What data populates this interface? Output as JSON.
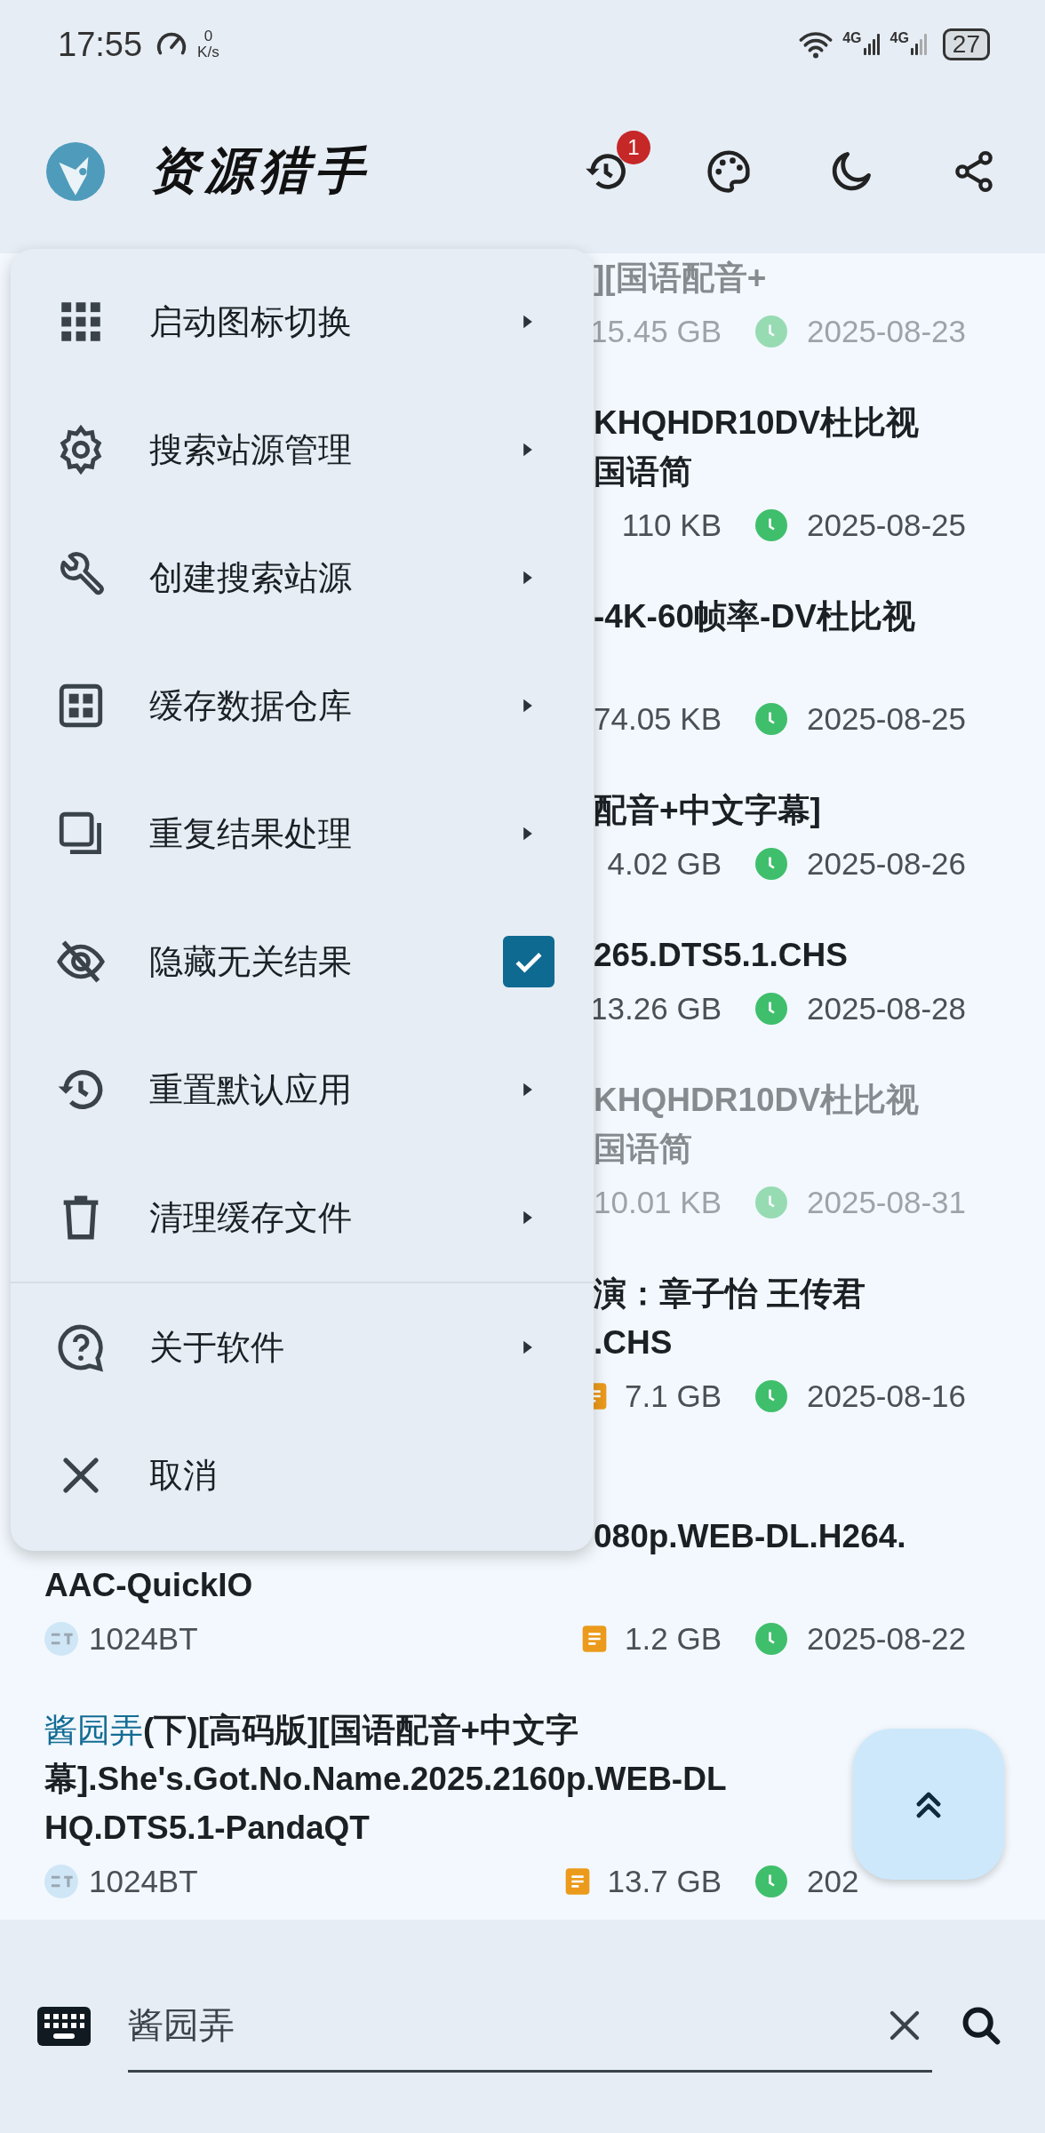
{
  "status_bar": {
    "time": "17:55",
    "speed_value": "0",
    "speed_unit": "K/s",
    "networks": [
      {
        "label": "4G"
      },
      {
        "label": "4G"
      }
    ],
    "battery": "27"
  },
  "app_bar": {
    "title": "资源猎手",
    "history_badge": "1"
  },
  "results": [
    {
      "lines": [
        {
          "text": "][国语配音+",
          "cut": true
        }
      ],
      "size": "15.45 GB",
      "date": "2025-08-23",
      "dimmed": true
    },
    {
      "lines": [
        {
          "text": "KHQHDR10DV杜比视",
          "cut": true
        },
        {
          "text": "国语简",
          "cut": true
        }
      ],
      "size": "110 KB",
      "date": "2025-08-25",
      "dimmed": false
    },
    {
      "lines": [
        {
          "text": "-4K-60帧率-DV杜比视",
          "cut": true
        }
      ],
      "size": "74.05 KB",
      "date": "2025-08-25",
      "dimmed": false
    },
    {
      "lines": [
        {
          "text": "配音+中文字幕]",
          "cut": true
        }
      ],
      "size": "4.02 GB",
      "date": "2025-08-26",
      "dimmed": false
    },
    {
      "lines": [
        {
          "text": "265.DTS5.1.CHS",
          "cut": true
        }
      ],
      "size": "13.26 GB",
      "date": "2025-08-28",
      "dimmed": false
    },
    {
      "lines": [
        {
          "text": "KHQHDR10DV杜比视",
          "cut": true
        },
        {
          "text": "国语简",
          "cut": true
        }
      ],
      "size": "10.01 KB",
      "date": "2025-08-31",
      "dimmed": true
    },
    {
      "lines": [
        {
          "text": "演：章子怡 王传君",
          "cut": true
        },
        {
          "text": ".CHS",
          "cut": true
        }
      ],
      "size_icon": true,
      "size": "7.1 GB",
      "date": "2025-08-16",
      "dimmed": false
    },
    {
      "lines": [
        {
          "text": "080p.WEB-DL.H264.",
          "cut": true
        },
        {
          "text": "AAC-QuickIO",
          "cut": false
        }
      ],
      "source": "1024BT",
      "size_icon": true,
      "size": "1.2 GB",
      "date": "2025-08-22",
      "dimmed": false
    },
    {
      "lines": [
        {
          "highlight": "酱园弄",
          "text": "(下)[高码版][国语配音+中文字",
          "cut": false
        },
        {
          "text": "幕].She's.Got.No.Name.2025.2160p.WEB-DL",
          "cut": false
        },
        {
          "text": "HQ.DTS5.1-PandaQT",
          "cut": false
        }
      ],
      "source": "1024BT",
      "size_icon": true,
      "size": "13.7 GB",
      "date": "202",
      "dimmed": false
    }
  ],
  "menu": {
    "sections": [
      [
        {
          "label": "启动图标切换",
          "kind": "submenu"
        },
        {
          "label": "搜索站源管理",
          "kind": "submenu"
        },
        {
          "label": "创建搜索站源",
          "kind": "submenu"
        },
        {
          "label": "缓存数据仓库",
          "kind": "submenu"
        },
        {
          "label": "重复结果处理",
          "kind": "submenu"
        },
        {
          "label": "隐藏无关结果",
          "kind": "checkbox",
          "checked": true
        },
        {
          "label": "重置默认应用",
          "kind": "submenu"
        },
        {
          "label": "清理缓存文件",
          "kind": "submenu"
        }
      ],
      [
        {
          "label": "关于软件",
          "kind": "submenu"
        },
        {
          "label": "取消",
          "kind": "action"
        }
      ]
    ]
  },
  "search": {
    "value": "酱园弄"
  }
}
